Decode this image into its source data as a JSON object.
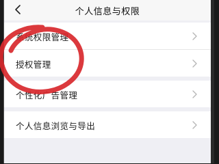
{
  "navbar": {
    "title": "个人信息与权限",
    "back_icon": "chevron-left-icon"
  },
  "groups": [
    {
      "items": [
        {
          "label": "系统权限管理"
        },
        {
          "label": "授权管理"
        }
      ]
    },
    {
      "items": [
        {
          "label": "个性化广告管理"
        }
      ]
    },
    {
      "items": [
        {
          "label": "个人信息浏览与导出"
        }
      ]
    }
  ],
  "colors": {
    "annotation_circle": "#d8282c",
    "background": "#efeff4"
  }
}
